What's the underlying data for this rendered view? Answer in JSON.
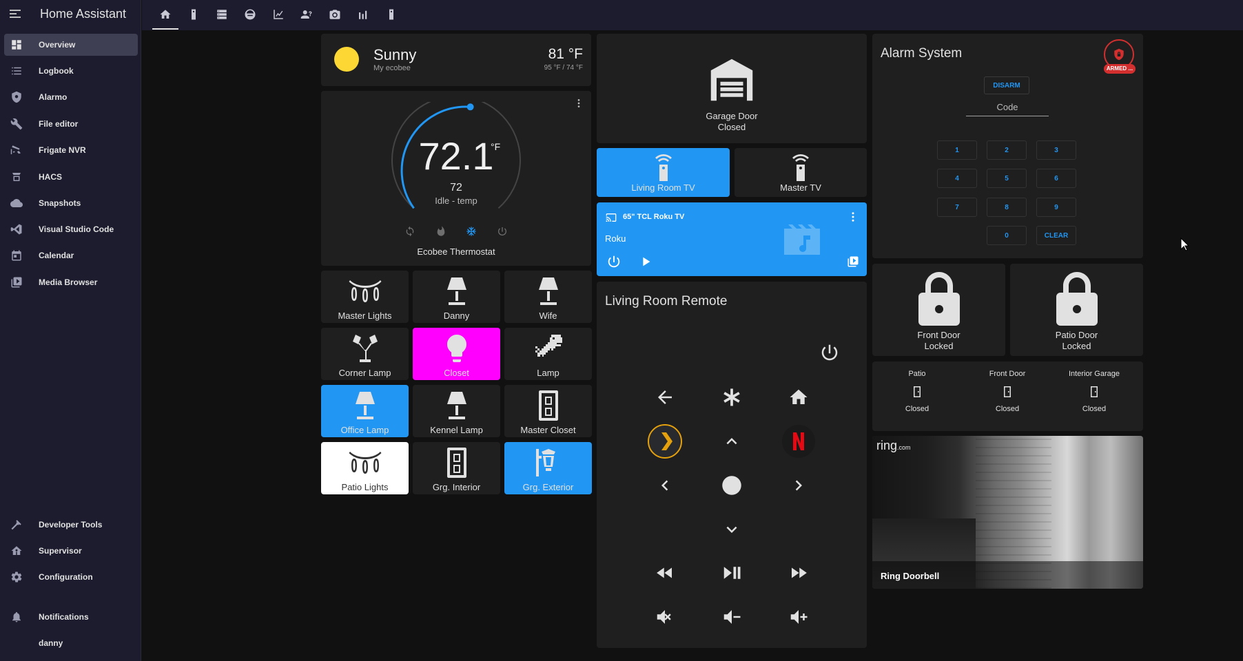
{
  "app": {
    "title": "Home Assistant"
  },
  "sidebar": {
    "items": [
      {
        "label": "Overview",
        "icon": "dashboard-icon"
      },
      {
        "label": "Logbook",
        "icon": "list-icon"
      },
      {
        "label": "Alarmo",
        "icon": "shield-icon"
      },
      {
        "label": "File editor",
        "icon": "wrench-icon"
      },
      {
        "label": "Frigate NVR",
        "icon": "cctv-icon"
      },
      {
        "label": "HACS",
        "icon": "hacs-icon"
      },
      {
        "label": "Snapshots",
        "icon": "cloud-icon"
      },
      {
        "label": "Visual Studio Code",
        "icon": "vscode-icon"
      },
      {
        "label": "Calendar",
        "icon": "calendar-icon"
      },
      {
        "label": "Media Browser",
        "icon": "media-icon"
      }
    ],
    "bottom": [
      {
        "label": "Developer Tools",
        "icon": "hammer-icon"
      },
      {
        "label": "Supervisor",
        "icon": "supervisor-icon"
      },
      {
        "label": "Configuration",
        "icon": "gear-icon"
      }
    ],
    "notifications": "Notifications",
    "user": "danny"
  },
  "weather": {
    "condition": "Sunny",
    "source": "My ecobee",
    "temp": "81 °F",
    "range": "95 °F / 74 °F"
  },
  "thermostat": {
    "target": "72.1",
    "unit": "°F",
    "current": "72",
    "state": "Idle - temp",
    "name": "Ecobee Thermostat"
  },
  "tiles": [
    {
      "label": "Master Lights"
    },
    {
      "label": "Danny"
    },
    {
      "label": "Wife"
    },
    {
      "label": "Corner Lamp"
    },
    {
      "label": "Closet"
    },
    {
      "label": "Lamp"
    },
    {
      "label": "Office Lamp"
    },
    {
      "label": "Kennel Lamp"
    },
    {
      "label": "Master Closet"
    },
    {
      "label": "Patio Lights"
    },
    {
      "label": "Grg. Interior"
    },
    {
      "label": "Grg. Exterior"
    }
  ],
  "garage": {
    "name": "Garage Door",
    "state": "Closed"
  },
  "tvs": [
    {
      "label": "Living Room TV"
    },
    {
      "label": "Master TV"
    }
  ],
  "media": {
    "device": "65\" TCL Roku TV",
    "app": "Roku"
  },
  "remote": {
    "title": "Living Room Remote"
  },
  "alarm": {
    "title": "Alarm System",
    "badge": "ARMED ...",
    "disarm": "DISARM",
    "code_placeholder": "Code",
    "keys": [
      "1",
      "2",
      "3",
      "4",
      "5",
      "6",
      "7",
      "8",
      "9",
      "0",
      "CLEAR"
    ]
  },
  "locks": [
    {
      "name": "Front Door",
      "state": "Locked"
    },
    {
      "name": "Patio Door",
      "state": "Locked"
    }
  ],
  "doors": [
    {
      "name": "Patio",
      "state": "Closed"
    },
    {
      "name": "Front Door",
      "state": "Closed"
    },
    {
      "name": "Interior Garage",
      "state": "Closed"
    }
  ],
  "camera": {
    "name": "Ring Doorbell",
    "logo": "ring",
    "logo_suffix": ".com"
  },
  "colors": {
    "accent": "#2196f3",
    "closet": "#ff00ff",
    "alarm": "#d32f2f",
    "sun": "#fdd835"
  }
}
